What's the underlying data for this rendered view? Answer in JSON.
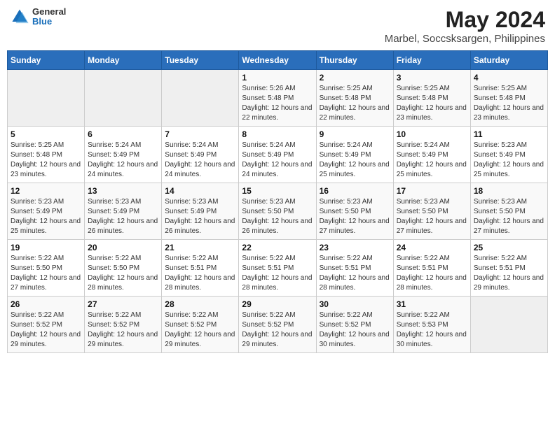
{
  "header": {
    "logo_general": "General",
    "logo_blue": "Blue",
    "title": "May 2024",
    "subtitle": "Marbel, Soccsksargen, Philippines"
  },
  "weekdays": [
    "Sunday",
    "Monday",
    "Tuesday",
    "Wednesday",
    "Thursday",
    "Friday",
    "Saturday"
  ],
  "weeks": [
    [
      {
        "day": "",
        "sunrise": "",
        "sunset": "",
        "daylight": "",
        "empty": true
      },
      {
        "day": "",
        "sunrise": "",
        "sunset": "",
        "daylight": "",
        "empty": true
      },
      {
        "day": "",
        "sunrise": "",
        "sunset": "",
        "daylight": "",
        "empty": true
      },
      {
        "day": "1",
        "sunrise": "Sunrise: 5:26 AM",
        "sunset": "Sunset: 5:48 PM",
        "daylight": "Daylight: 12 hours and 22 minutes."
      },
      {
        "day": "2",
        "sunrise": "Sunrise: 5:25 AM",
        "sunset": "Sunset: 5:48 PM",
        "daylight": "Daylight: 12 hours and 22 minutes."
      },
      {
        "day": "3",
        "sunrise": "Sunrise: 5:25 AM",
        "sunset": "Sunset: 5:48 PM",
        "daylight": "Daylight: 12 hours and 23 minutes."
      },
      {
        "day": "4",
        "sunrise": "Sunrise: 5:25 AM",
        "sunset": "Sunset: 5:48 PM",
        "daylight": "Daylight: 12 hours and 23 minutes."
      }
    ],
    [
      {
        "day": "5",
        "sunrise": "Sunrise: 5:25 AM",
        "sunset": "Sunset: 5:48 PM",
        "daylight": "Daylight: 12 hours and 23 minutes."
      },
      {
        "day": "6",
        "sunrise": "Sunrise: 5:24 AM",
        "sunset": "Sunset: 5:49 PM",
        "daylight": "Daylight: 12 hours and 24 minutes."
      },
      {
        "day": "7",
        "sunrise": "Sunrise: 5:24 AM",
        "sunset": "Sunset: 5:49 PM",
        "daylight": "Daylight: 12 hours and 24 minutes."
      },
      {
        "day": "8",
        "sunrise": "Sunrise: 5:24 AM",
        "sunset": "Sunset: 5:49 PM",
        "daylight": "Daylight: 12 hours and 24 minutes."
      },
      {
        "day": "9",
        "sunrise": "Sunrise: 5:24 AM",
        "sunset": "Sunset: 5:49 PM",
        "daylight": "Daylight: 12 hours and 25 minutes."
      },
      {
        "day": "10",
        "sunrise": "Sunrise: 5:24 AM",
        "sunset": "Sunset: 5:49 PM",
        "daylight": "Daylight: 12 hours and 25 minutes."
      },
      {
        "day": "11",
        "sunrise": "Sunrise: 5:23 AM",
        "sunset": "Sunset: 5:49 PM",
        "daylight": "Daylight: 12 hours and 25 minutes."
      }
    ],
    [
      {
        "day": "12",
        "sunrise": "Sunrise: 5:23 AM",
        "sunset": "Sunset: 5:49 PM",
        "daylight": "Daylight: 12 hours and 25 minutes."
      },
      {
        "day": "13",
        "sunrise": "Sunrise: 5:23 AM",
        "sunset": "Sunset: 5:49 PM",
        "daylight": "Daylight: 12 hours and 26 minutes."
      },
      {
        "day": "14",
        "sunrise": "Sunrise: 5:23 AM",
        "sunset": "Sunset: 5:49 PM",
        "daylight": "Daylight: 12 hours and 26 minutes."
      },
      {
        "day": "15",
        "sunrise": "Sunrise: 5:23 AM",
        "sunset": "Sunset: 5:50 PM",
        "daylight": "Daylight: 12 hours and 26 minutes."
      },
      {
        "day": "16",
        "sunrise": "Sunrise: 5:23 AM",
        "sunset": "Sunset: 5:50 PM",
        "daylight": "Daylight: 12 hours and 27 minutes."
      },
      {
        "day": "17",
        "sunrise": "Sunrise: 5:23 AM",
        "sunset": "Sunset: 5:50 PM",
        "daylight": "Daylight: 12 hours and 27 minutes."
      },
      {
        "day": "18",
        "sunrise": "Sunrise: 5:23 AM",
        "sunset": "Sunset: 5:50 PM",
        "daylight": "Daylight: 12 hours and 27 minutes."
      }
    ],
    [
      {
        "day": "19",
        "sunrise": "Sunrise: 5:22 AM",
        "sunset": "Sunset: 5:50 PM",
        "daylight": "Daylight: 12 hours and 27 minutes."
      },
      {
        "day": "20",
        "sunrise": "Sunrise: 5:22 AM",
        "sunset": "Sunset: 5:50 PM",
        "daylight": "Daylight: 12 hours and 28 minutes."
      },
      {
        "day": "21",
        "sunrise": "Sunrise: 5:22 AM",
        "sunset": "Sunset: 5:51 PM",
        "daylight": "Daylight: 12 hours and 28 minutes."
      },
      {
        "day": "22",
        "sunrise": "Sunrise: 5:22 AM",
        "sunset": "Sunset: 5:51 PM",
        "daylight": "Daylight: 12 hours and 28 minutes."
      },
      {
        "day": "23",
        "sunrise": "Sunrise: 5:22 AM",
        "sunset": "Sunset: 5:51 PM",
        "daylight": "Daylight: 12 hours and 28 minutes."
      },
      {
        "day": "24",
        "sunrise": "Sunrise: 5:22 AM",
        "sunset": "Sunset: 5:51 PM",
        "daylight": "Daylight: 12 hours and 28 minutes."
      },
      {
        "day": "25",
        "sunrise": "Sunrise: 5:22 AM",
        "sunset": "Sunset: 5:51 PM",
        "daylight": "Daylight: 12 hours and 29 minutes."
      }
    ],
    [
      {
        "day": "26",
        "sunrise": "Sunrise: 5:22 AM",
        "sunset": "Sunset: 5:52 PM",
        "daylight": "Daylight: 12 hours and 29 minutes."
      },
      {
        "day": "27",
        "sunrise": "Sunrise: 5:22 AM",
        "sunset": "Sunset: 5:52 PM",
        "daylight": "Daylight: 12 hours and 29 minutes."
      },
      {
        "day": "28",
        "sunrise": "Sunrise: 5:22 AM",
        "sunset": "Sunset: 5:52 PM",
        "daylight": "Daylight: 12 hours and 29 minutes."
      },
      {
        "day": "29",
        "sunrise": "Sunrise: 5:22 AM",
        "sunset": "Sunset: 5:52 PM",
        "daylight": "Daylight: 12 hours and 29 minutes."
      },
      {
        "day": "30",
        "sunrise": "Sunrise: 5:22 AM",
        "sunset": "Sunset: 5:52 PM",
        "daylight": "Daylight: 12 hours and 30 minutes."
      },
      {
        "day": "31",
        "sunrise": "Sunrise: 5:22 AM",
        "sunset": "Sunset: 5:53 PM",
        "daylight": "Daylight: 12 hours and 30 minutes."
      },
      {
        "day": "",
        "sunrise": "",
        "sunset": "",
        "daylight": "",
        "empty": true
      }
    ]
  ]
}
